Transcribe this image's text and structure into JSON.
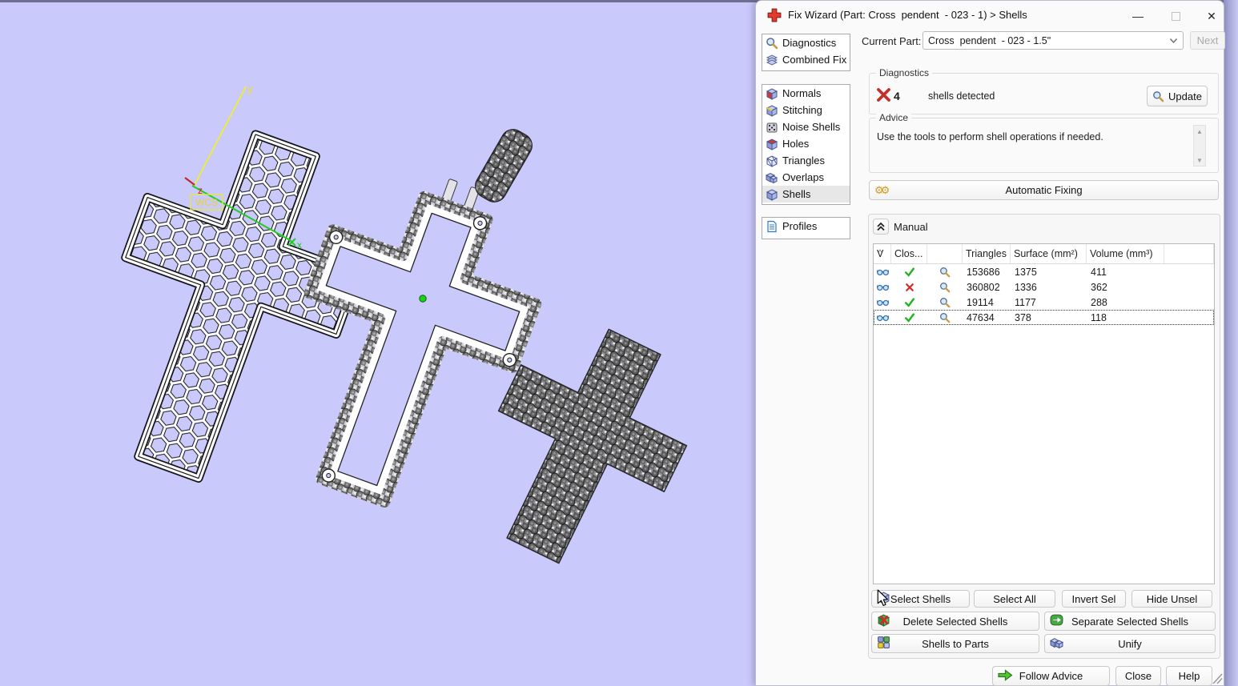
{
  "window": {
    "title": "Fix Wizard (Part: Cross  pendent  - 023 - 1) > Shells"
  },
  "header": {
    "current_part_label": "Current Part:",
    "current_part_value": "Cross  pendent  - 023 - 1.5\"",
    "next_button": "Next"
  },
  "sidebar": {
    "top_items": [
      {
        "label": "Diagnostics",
        "icon": "diagnostics-icon"
      },
      {
        "label": "Combined Fix",
        "icon": "combined-fix-icon"
      }
    ],
    "tool_items": [
      {
        "label": "Normals",
        "icon": "normals-icon"
      },
      {
        "label": "Stitching",
        "icon": "stitching-icon"
      },
      {
        "label": "Noise Shells",
        "icon": "noise-shells-icon"
      },
      {
        "label": "Holes",
        "icon": "holes-icon"
      },
      {
        "label": "Triangles",
        "icon": "triangles-icon"
      },
      {
        "label": "Overlaps",
        "icon": "overlaps-icon"
      },
      {
        "label": "Shells",
        "icon": "shells-icon",
        "selected": true
      }
    ],
    "bottom_items": [
      {
        "label": "Profiles",
        "icon": "profiles-icon"
      }
    ],
    "selected_item": "Shells"
  },
  "diagnostics": {
    "group_label": "Diagnostics",
    "count": "4",
    "message": "shells detected",
    "update_button": "Update"
  },
  "advice": {
    "group_label": "Advice",
    "text": "Use the tools to perform shell operations if needed."
  },
  "automatic_fixing_button": "Automatic Fixing",
  "manual": {
    "label": "Manual",
    "table": {
      "sort_indicator": "^",
      "columns": [
        "V",
        "Clos...",
        "",
        "Triangles",
        "Surface (mm²)",
        "Volume (mm³)"
      ],
      "rows": [
        {
          "visible": true,
          "closed": true,
          "triangles": "153686",
          "surface": "1375",
          "volume": "411",
          "selected": false
        },
        {
          "visible": true,
          "closed": false,
          "triangles": "360802",
          "surface": "1336",
          "volume": "362",
          "selected": false
        },
        {
          "visible": true,
          "closed": true,
          "triangles": "19114",
          "surface": "1177",
          "volume": "288",
          "selected": false
        },
        {
          "visible": true,
          "closed": true,
          "triangles": "47634",
          "surface": "378",
          "volume": "118",
          "selected": true
        }
      ]
    },
    "buttons": {
      "select_shells": "Select Shells",
      "select_all": "Select All",
      "invert_sel": "Invert Sel",
      "hide_unsel": "Hide Unsel",
      "delete_selected": "Delete Selected Shells",
      "separate_selected": "Separate Selected Shells",
      "shells_to_parts": "Shells to Parts",
      "unify": "Unify"
    }
  },
  "footer": {
    "follow_advice": "Follow Advice",
    "close": "Close",
    "help": "Help"
  },
  "viewport": {
    "axes": {
      "x_label": "x",
      "y_label": "y",
      "z_label": "z",
      "wcs_label": "WCS"
    }
  },
  "colors": {
    "viewport_background": "#c9c9fb",
    "window_edge_purple": "#9d9ed2",
    "check_green": "#21b421",
    "error_red": "#d42a2a",
    "axis_yellow": "#f0f02a",
    "axis_green": "#22cc22",
    "axis_red": "#cc2222",
    "selection_green_dot": "#19d119"
  },
  "icons": {
    "fix-wizard-icon": "red plus cross",
    "diagnostics-icon": "magnifier",
    "combined-fix-icon": "stacked layers",
    "normals-icon": "cube with red face",
    "stitching-icon": "cube with yellow seam",
    "noise-shells-icon": "dotted cube",
    "holes-icon": "cube with red top",
    "triangles-icon": "wireframe cube",
    "overlaps-icon": "two overlapping cubes",
    "shells-icon": "blue cube",
    "profiles-icon": "document with lines",
    "error-icon": "✖",
    "update-icon": "magnifier",
    "automatic-fixing-icon": "⚙⚙ gears",
    "collapse-icon": "double chevron up",
    "visible-icon": "glasses",
    "closed-icon": "✔",
    "not-closed-icon": "✖",
    "inspect-icon": "magnifier",
    "select-shells-icon": "cube with pointer",
    "delete-shells-icon": "cube with red x",
    "separate-shells-icon": "green arrow badge",
    "shells-to-parts-icon": "four colored cubes",
    "unify-icon": "two joined cubes",
    "follow-advice-icon": "green right arrow",
    "minimize-icon": "–",
    "maximize-icon": "□",
    "close-icon": "✕",
    "dropdown-chevron-icon": "v",
    "scroll-up-icon": "▲",
    "scroll-down-icon": "▼",
    "resize-grip-icon": "diagonal lines",
    "cursor-icon": "arrow pointer"
  }
}
